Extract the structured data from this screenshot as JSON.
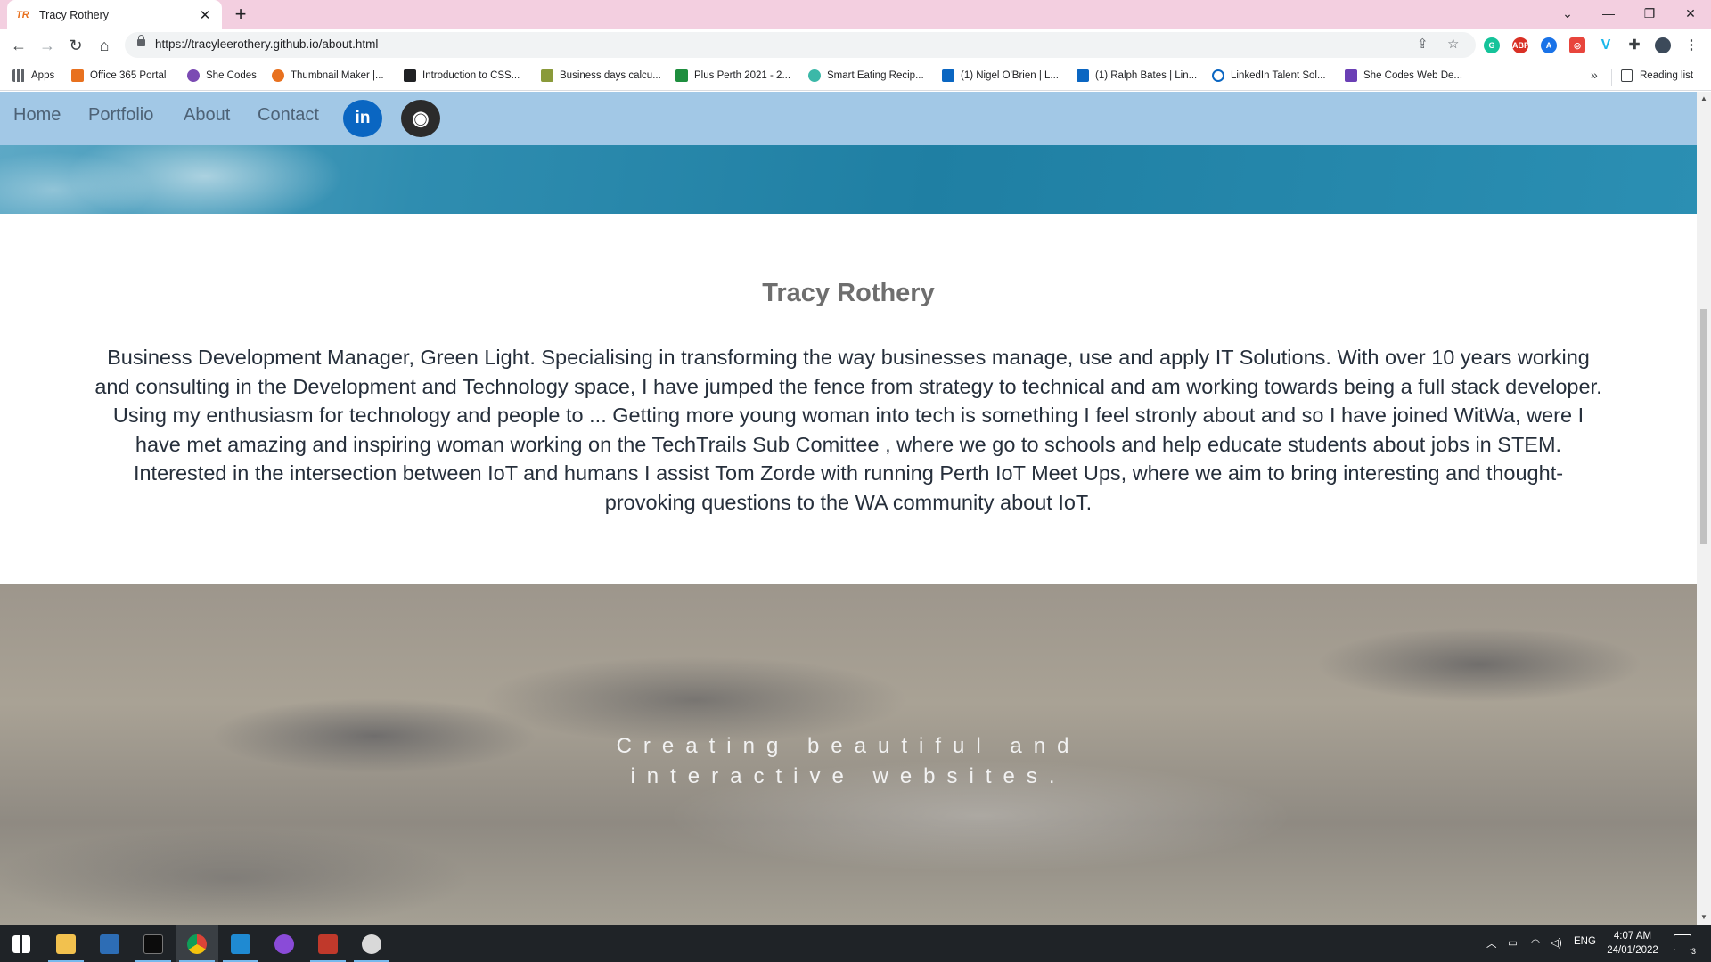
{
  "browser": {
    "tab_title": "Tracy Rothery",
    "tab_favicon": "TR",
    "url": "https://tracyleerothery.github.io/about.html",
    "bookmarks": [
      {
        "label": "Apps",
        "color": "#5f6368"
      },
      {
        "label": "Office 365 Portal",
        "color": "#e8711f"
      },
      {
        "label": "She Codes",
        "color": "#7b4bb3"
      },
      {
        "label": "Thumbnail Maker |...",
        "color": "#e8711f"
      },
      {
        "label": "Introduction to CSS...",
        "color": "#202124"
      },
      {
        "label": "Business days calcu...",
        "color": "#8a9a3a"
      },
      {
        "label": "Plus Perth 2021 - 2...",
        "color": "#1e8e3e"
      },
      {
        "label": "Smart Eating Recip...",
        "color": "#3bb8a8"
      },
      {
        "label": "(1) Nigel O'Brien | L...",
        "color": "#0a66c2"
      },
      {
        "label": "(1) Ralph Bates | Lin...",
        "color": "#0a66c2"
      },
      {
        "label": "LinkedIn Talent Sol...",
        "color": "#0a66c2"
      },
      {
        "label": "She Codes Web De...",
        "color": "#6a3fb5"
      }
    ],
    "more_bookmarks": "»",
    "reading_list": "Reading list"
  },
  "site": {
    "nav": [
      "Home",
      "Portfolio",
      "About",
      "Contact"
    ],
    "social": [
      {
        "name": "linkedin",
        "glyph": "in",
        "color": "#0a66c2"
      },
      {
        "name": "github",
        "glyph": "◉",
        "color": "#2b2b2b"
      }
    ],
    "about_title": "Tracy Rothery",
    "about_text": "Business Development Manager, Green Light. Specialising in transforming the way businesses manage, use and apply IT Solutions. With over 10 years working and consulting in the Development and Technology space, I have jumped the fence from strategy to technical and am working towards being a full stack developer. Using my enthusiasm for technology and people to ... Getting more young woman into tech is something I feel stronly about and so I have joined WitWa, were I have met amazing and inspiring woman working on the TechTrails Sub Comittee , where we go to schools and help educate students about jobs in STEM. Interested in the intersection between IoT and humans I assist Tom Zorde with running Perth IoT Meet Ups, where we aim to bring interesting and thought-provoking questions to the WA community about IoT.",
    "tagline": "Creating beautiful and interactive websites."
  },
  "taskbar": {
    "language": "ENG",
    "time": "4:07 AM",
    "date": "24/01/2022",
    "notification_count": "3"
  }
}
